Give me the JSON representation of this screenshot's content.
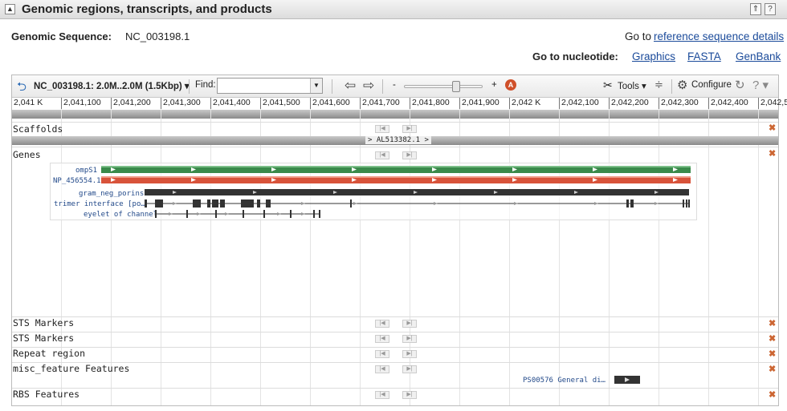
{
  "header": {
    "title": "Genomic regions, transcripts, and products"
  },
  "genomic": {
    "label": "Genomic Sequence:",
    "accession": "NC_003198.1"
  },
  "links": {
    "goto_prefix": "Go to",
    "refseq_details": "reference sequence details",
    "goto_nucleotide": "Go to nucleotide:",
    "graphics": "Graphics",
    "fasta": "FASTA",
    "genbank": "GenBank"
  },
  "toolbar": {
    "region": "NC_003198.1: 2.0M..2.0M (1.5Kbp)",
    "find_label": "Find:",
    "find_value": "",
    "zoom_minus": "-",
    "zoom_plus": "+",
    "tools": "Tools",
    "configure": "Configure",
    "help": "?"
  },
  "ruler": {
    "ticks": [
      "2,041 K",
      "2,041,100",
      "2,041,200",
      "2,041,300",
      "2,041,400",
      "2,041,500",
      "2,041,600",
      "2,041,700",
      "2,041,800",
      "2,041,900",
      "2,042 K",
      "2,042,100",
      "2,042,200",
      "2,042,300",
      "2,042,400",
      "2,042,5"
    ]
  },
  "tracks": {
    "scaffolds": "Scaffolds",
    "scaffold_name": "AL513382.1",
    "genes": "Genes",
    "sts1": "STS Markers",
    "sts2": "STS Markers",
    "repeat": "Repeat region",
    "misc": "misc_feature Features",
    "rbs": "RBS Features"
  },
  "features": {
    "gene": "ompS1",
    "protein": "NP_456554.1",
    "cdd1": "gram_neg_porins",
    "cdd2": "trimer interface [po…",
    "cdd3": "eyelet of channel",
    "misc": "PS00576 General di…"
  },
  "colors": {
    "gene": "#3a8a4a",
    "protein": "#d8533a",
    "domain": "#333333",
    "close": "#cc6633"
  }
}
